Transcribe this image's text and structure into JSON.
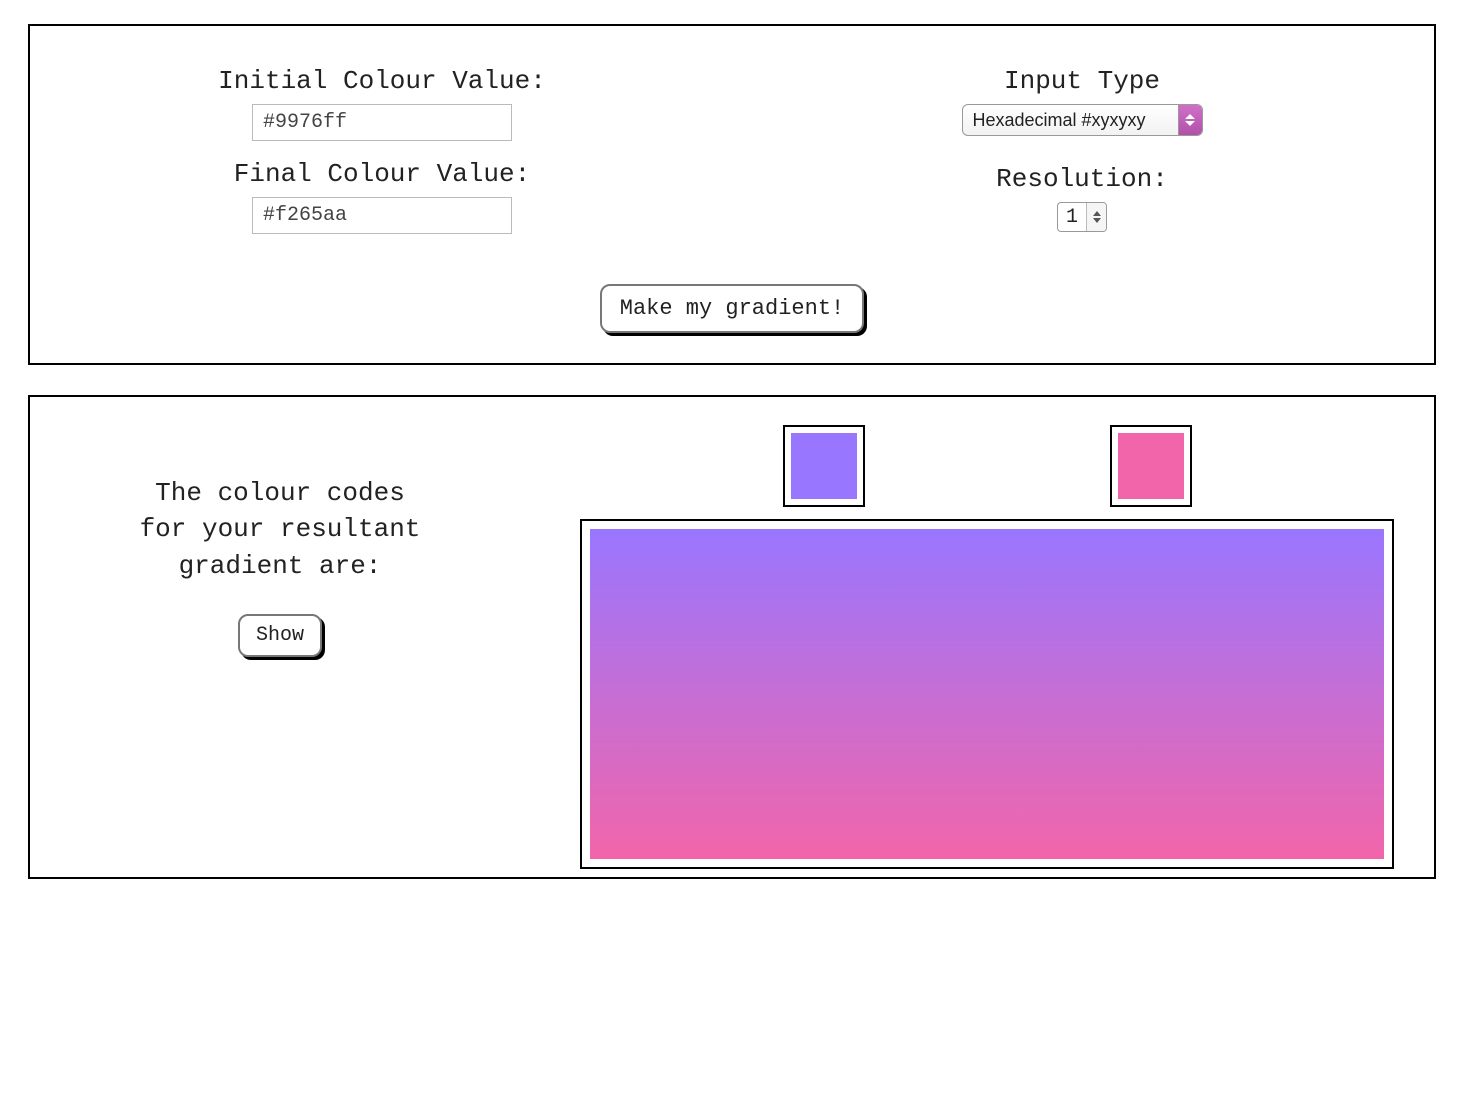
{
  "inputs": {
    "initial_label": "Initial Colour Value:",
    "initial_value": "#9976ff",
    "final_label": "Final Colour Value:",
    "final_value": "#f265aa",
    "type_label": "Input Type",
    "type_selected": "Hexadecimal #xyxyxy",
    "resolution_label": "Resolution:",
    "resolution_value": "1",
    "submit_label": "Make my gradient!"
  },
  "result": {
    "description_line1": "The colour codes",
    "description_line2": "for your resultant",
    "description_line3": "gradient are:",
    "show_label": "Show",
    "start_color": "#9976ff",
    "end_color": "#f265aa"
  },
  "colors": {
    "start": "#9976ff",
    "end": "#f265aa"
  }
}
